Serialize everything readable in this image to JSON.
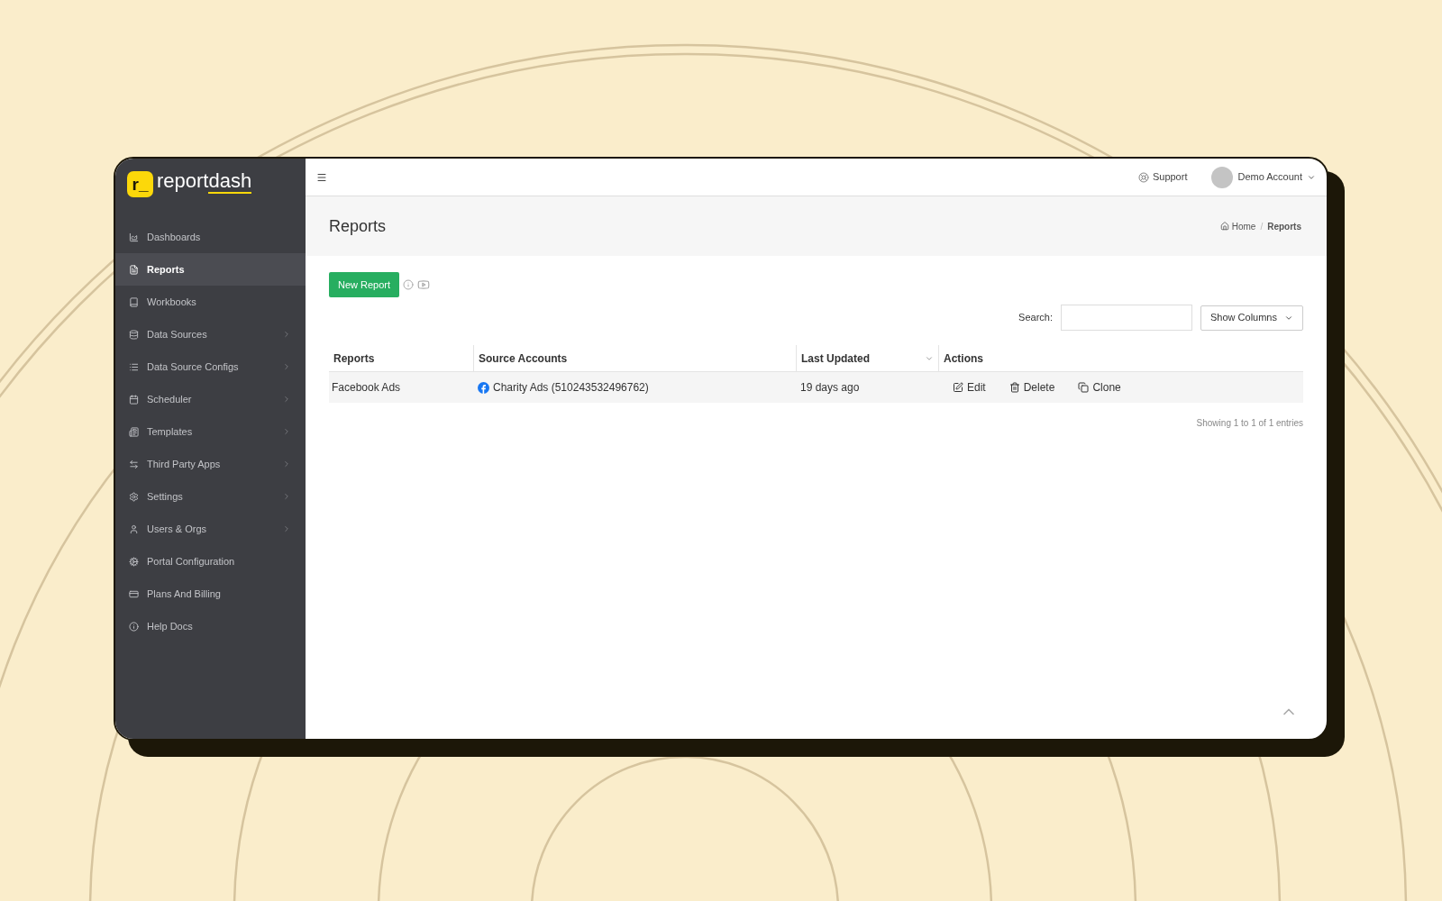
{
  "logo": {
    "mark": "r_",
    "word": "report",
    "word_accent": "dash"
  },
  "sidebar": {
    "items": [
      {
        "label": "Dashboards",
        "selected": false,
        "has_submenu": false
      },
      {
        "label": "Reports",
        "selected": true,
        "has_submenu": false
      },
      {
        "label": "Workbooks",
        "selected": false,
        "has_submenu": false
      },
      {
        "label": "Data Sources",
        "selected": false,
        "has_submenu": true
      },
      {
        "label": "Data Source Configs",
        "selected": false,
        "has_submenu": true
      },
      {
        "label": "Scheduler",
        "selected": false,
        "has_submenu": true
      },
      {
        "label": "Templates",
        "selected": false,
        "has_submenu": true
      },
      {
        "label": "Third Party Apps",
        "selected": false,
        "has_submenu": true
      },
      {
        "label": "Settings",
        "selected": false,
        "has_submenu": true
      },
      {
        "label": "Users & Orgs",
        "selected": false,
        "has_submenu": true
      },
      {
        "label": "Portal Configuration",
        "selected": false,
        "has_submenu": false
      },
      {
        "label": "Plans And Billing",
        "selected": false,
        "has_submenu": false
      },
      {
        "label": "Help Docs",
        "selected": false,
        "has_submenu": false
      }
    ]
  },
  "topbar": {
    "support": "Support",
    "account": "Demo Account"
  },
  "page": {
    "title": "Reports",
    "breadcrumb": [
      "Home",
      "Reports"
    ],
    "breadcrumb_separator": "/"
  },
  "new_report_button": "New Report",
  "search": {
    "label": "Search:"
  },
  "show_columns_button": "Show Columns",
  "table": {
    "columns": [
      {
        "label": "Reports",
        "sorted": false
      },
      {
        "label": "Source Accounts",
        "sorted": false
      },
      {
        "label": "Last Updated",
        "sorted": true
      },
      {
        "label": "Actions",
        "sorted": false
      }
    ],
    "rows": [
      {
        "report": "Facebook Ads",
        "source": "Charity Ads (510243532496762)",
        "updated": "19 days ago",
        "actions": [
          "Edit",
          "Delete",
          "Clone"
        ]
      }
    ]
  },
  "footer": "Showing 1 to 1 of 1 entries"
}
